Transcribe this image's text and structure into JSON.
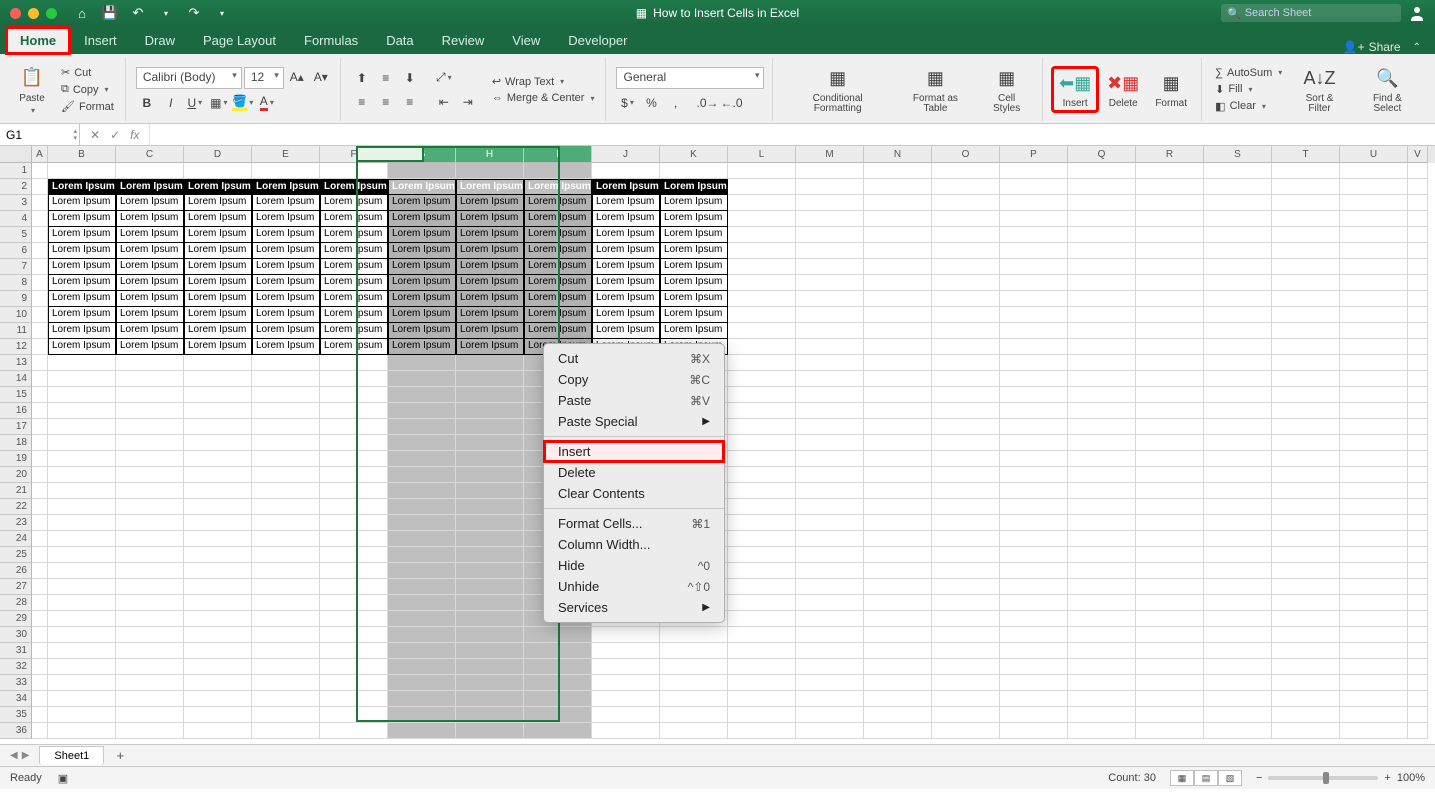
{
  "title": "How to Insert Cells in Excel",
  "search_placeholder": "Search Sheet",
  "tabs": [
    "Home",
    "Insert",
    "Draw",
    "Page Layout",
    "Formulas",
    "Data",
    "Review",
    "View",
    "Developer"
  ],
  "share_label": "Share",
  "ribbon": {
    "paste": "Paste",
    "cut": "Cut",
    "copy": "Copy",
    "format_painter": "Format",
    "font_name": "Calibri (Body)",
    "font_size": "12",
    "wrap": "Wrap Text",
    "merge": "Merge & Center",
    "number_format": "General",
    "cond_fmt": "Conditional Formatting",
    "fmt_table": "Format as Table",
    "cell_styles": "Cell Styles",
    "insert": "Insert",
    "delete": "Delete",
    "format": "Format",
    "autosum": "AutoSum",
    "fill": "Fill",
    "clear": "Clear",
    "sort": "Sort & Filter",
    "find": "Find & Select"
  },
  "namebox": "G1",
  "columns": [
    "A",
    "B",
    "C",
    "D",
    "E",
    "F",
    "G",
    "H",
    "I",
    "J",
    "K",
    "L",
    "M",
    "N",
    "O",
    "P",
    "Q",
    "R",
    "S",
    "T",
    "U",
    "V"
  ],
  "col_widths": {
    "A": 16,
    "default": 68,
    "V": 20
  },
  "selected_cols": [
    "G",
    "H",
    "I"
  ],
  "data_cols": [
    "B",
    "C",
    "D",
    "E",
    "F",
    "G",
    "H",
    "I",
    "J",
    "K"
  ],
  "row_count": 36,
  "header_row": 2,
  "data_rows_start": 3,
  "data_rows_end": 12,
  "cell_text": "Lorem Ipsum",
  "context_menu": [
    {
      "label": "Cut",
      "shortcut": "⌘X"
    },
    {
      "label": "Copy",
      "shortcut": "⌘C"
    },
    {
      "label": "Paste",
      "shortcut": "⌘V"
    },
    {
      "label": "Paste Special",
      "submenu": true
    },
    {
      "sep": true
    },
    {
      "label": "Insert",
      "highlight": true
    },
    {
      "label": "Delete"
    },
    {
      "label": "Clear Contents"
    },
    {
      "sep": true
    },
    {
      "label": "Format Cells...",
      "shortcut": "⌘1"
    },
    {
      "label": "Column Width..."
    },
    {
      "label": "Hide",
      "shortcut": "^0"
    },
    {
      "label": "Unhide",
      "shortcut": "^⇧0"
    },
    {
      "label": "Services",
      "submenu": true
    }
  ],
  "sheet_name": "Sheet1",
  "status": {
    "ready": "Ready",
    "count_label": "Count:",
    "count_value": "30",
    "zoom": "100%"
  }
}
